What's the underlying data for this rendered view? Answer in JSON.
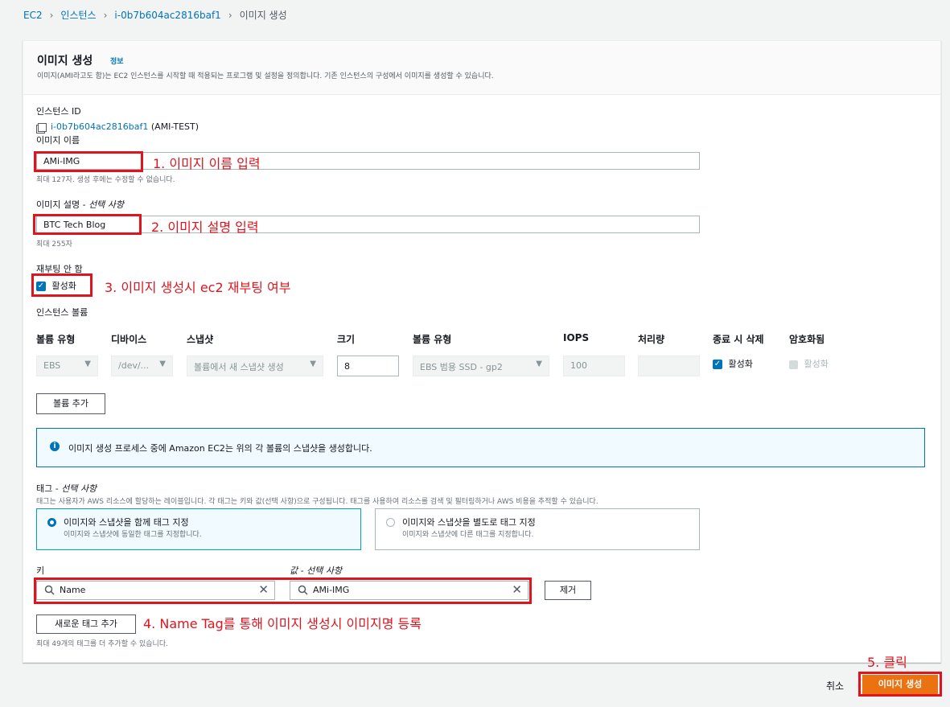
{
  "breadcrumb": {
    "items": [
      "EC2",
      "인스턴스",
      "i-0b7b604ac2816baf1"
    ],
    "current": "이미지 생성"
  },
  "header": {
    "title": "이미지 생성",
    "info": "정보",
    "description": "이미지(AMI라고도 함)는 EC2 인스턴스를 시작할 때 적용되는 프로그램 및 설정을 정의합니다. 기존 인스턴스의 구성에서 이미지를 생성할 수 있습니다."
  },
  "instance": {
    "label": "인스턴스 ID",
    "id": "i-0b7b604ac2816baf1",
    "name": " (AMI-TEST)"
  },
  "image_name": {
    "label": "이미지 이름",
    "value": "AMi-IMG",
    "hint": "최대 127자. 생성 후에는 수정할 수 없습니다."
  },
  "image_desc": {
    "label": "이미지 설명 - ",
    "optional": "선택 사항",
    "value": "BTC Tech Blog",
    "hint": "최대 255자"
  },
  "reboot": {
    "label": "재부팅 안 함",
    "checkbox": "활성화"
  },
  "volumes": {
    "label": "인스턴스 볼륨",
    "headers": [
      "볼륨 유형",
      "디바이스",
      "스냅샷",
      "크기",
      "볼륨 유형",
      "IOPS",
      "처리량",
      "종료 시 삭제",
      "암호화됨"
    ],
    "row": {
      "type": "EBS",
      "device": "/dev/...",
      "snapshot": "볼륨에서 새 스냅샷 생성",
      "size": "8",
      "volume_type": "EBS 범용 SSD - gp2",
      "iops": "100",
      "throughput": "",
      "delete": "활성화",
      "encrypted": "활성화"
    },
    "add_button": "볼륨 추가"
  },
  "notice": "이미지 생성 프로세스 중에 Amazon EC2는 위의 각 볼륨의 스냅샷을 생성합니다.",
  "tags": {
    "label": "태그 - ",
    "optional": "선택 사항",
    "desc": "태그는 사용자가 AWS 리소스에 할당하는 레이블입니다. 각 태그는 키와 값(선택 사항)으로 구성됩니다. 태그를 사용하여 리소스를 검색 및 필터링하거나 AWS 비용을 추적할 수 있습니다.",
    "option1_title": "이미지와 스냅샷을 함께 태그 지정",
    "option1_desc": "이미지와 스냅샷에 동일한 태그를 지정합니다.",
    "option2_title": "이미지와 스냅샷을 별도로 태그 지정",
    "option2_desc": "이미지와 스냅샷에 다른 태그를 지정합니다.",
    "key_label": "키",
    "value_label": "값 - ",
    "value_optional": "선택 사항",
    "key_value": "Name",
    "value_value": "AMi-IMG",
    "remove": "제거",
    "add": "새로운 태그 추가",
    "hint": "최대 49개의 태그를 더 추가할 수 있습니다."
  },
  "footer": {
    "cancel": "취소",
    "create": "이미지 생성"
  },
  "annotations": {
    "a1": "1. 이미지 이름 입력",
    "a2": "2. 이미지 설명 입력",
    "a3": "3. 이미지 생성시 ec2 재부팅 여부",
    "a4": "4. Name Tag를 통해 이미지 생성시 이미지명 등록",
    "a5": "5. 클릭"
  },
  "colors": {
    "accent": "#ec7211",
    "link": "#0073bb",
    "annotation": "#e0141e"
  }
}
